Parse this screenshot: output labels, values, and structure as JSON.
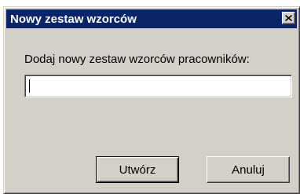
{
  "window": {
    "title": "Nowy zestaw wzorców",
    "close_icon": "close-icon"
  },
  "form": {
    "prompt": "Dodaj nowy zestaw wzorców pracowników:",
    "input_value": ""
  },
  "buttons": {
    "create_label": "Utwórz",
    "cancel_label": "Anuluj"
  },
  "colors": {
    "title_bar": "#0a246a",
    "dialog_face": "#d4d0c8"
  }
}
